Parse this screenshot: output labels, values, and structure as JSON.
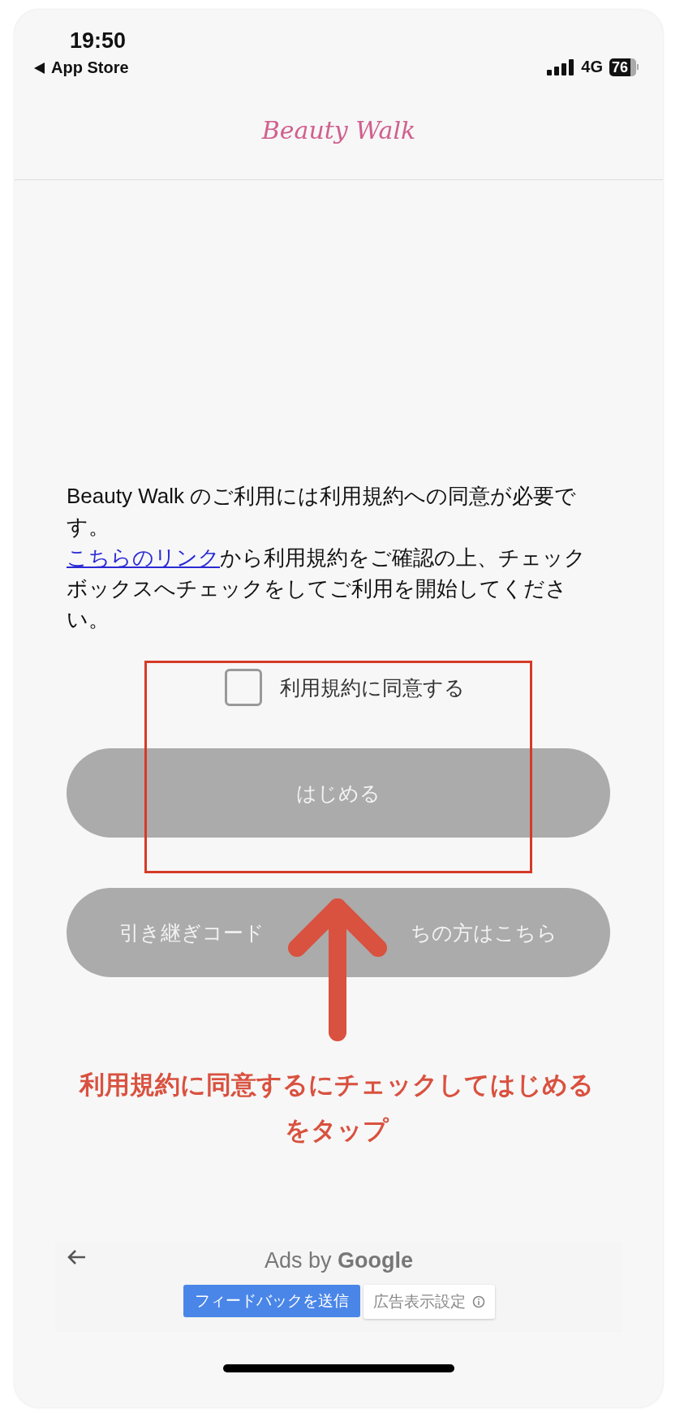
{
  "status_bar": {
    "time": "19:50",
    "back_label": "App Store",
    "network": "4G",
    "battery": "76"
  },
  "header": {
    "logo": "Beauty Walk"
  },
  "notice": {
    "intro": "Beauty Walk のご利用には利用規約への同意が必要です。",
    "link": "こちらのリンク",
    "rest": "から利用規約をご確認の上、チェックボックスへチェックをしてご利用を開始してください。"
  },
  "agree": {
    "label": "利用規約に同意する",
    "checked": false
  },
  "buttons": [
    {
      "label_parts": [
        "はじめる"
      ],
      "disabled": true
    },
    {
      "label_parts": [
        "引き継ぎコード",
        "ちの方はこちら"
      ],
      "disabled": true
    }
  ],
  "annotation": {
    "caption": "利用規約に同意するにチェックしてはじめるをタップ"
  },
  "ads": {
    "label": "Ads by **Google**",
    "feedback": "フィードバックを送信",
    "settings": "広告表示設定"
  }
}
